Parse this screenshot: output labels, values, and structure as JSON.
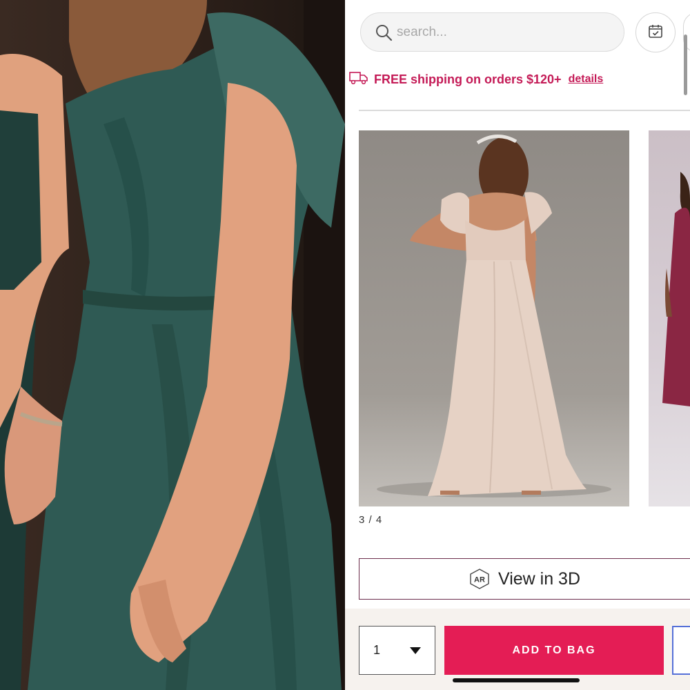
{
  "search": {
    "placeholder": "search..."
  },
  "header": {
    "calendar_icon": "calendar-check-icon"
  },
  "shipping": {
    "icon": "delivery-truck-icon",
    "text": "FREE shipping on orders $120+",
    "link": "details",
    "color": "#c41a56"
  },
  "gallery": {
    "counter": "3 / 4"
  },
  "view3d": {
    "badge": "AR",
    "label": "View in 3D"
  },
  "purchase": {
    "quantity": "1",
    "add_to_bag": "ADD TO BAG",
    "button_color": "#e41d55"
  }
}
